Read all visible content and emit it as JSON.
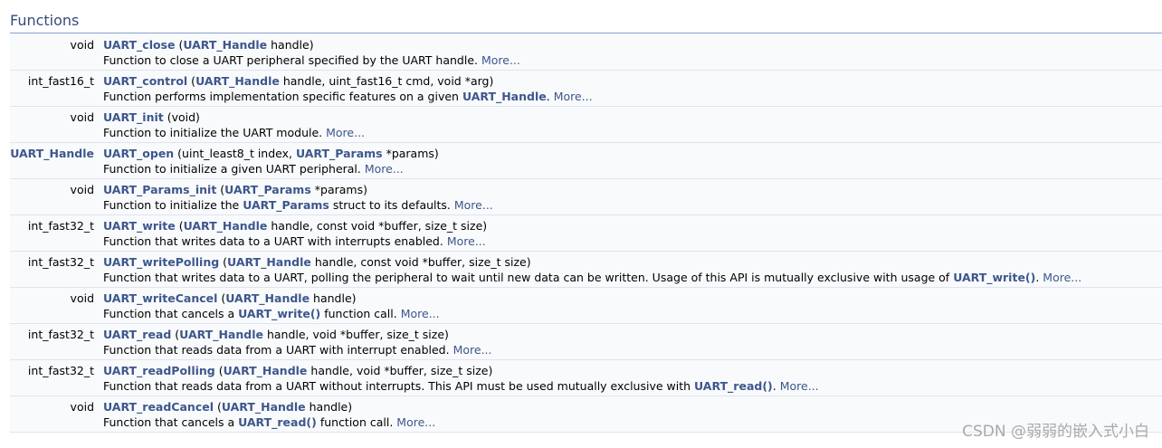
{
  "section": {
    "title": "Functions"
  },
  "functions": [
    {
      "ret": "void",
      "ret_link": false,
      "name": "UART_close",
      "sig": [
        {
          "t": " ("
        },
        {
          "l": "UART_Handle"
        },
        {
          "t": " handle)"
        }
      ],
      "brief": [
        {
          "t": "Function to close a UART peripheral specified by the UART handle. "
        },
        {
          "m": "More..."
        }
      ]
    },
    {
      "ret": "int_fast16_t",
      "ret_link": false,
      "name": "UART_control",
      "sig": [
        {
          "t": " ("
        },
        {
          "l": "UART_Handle"
        },
        {
          "t": " handle, uint_fast16_t cmd, void *arg)"
        }
      ],
      "brief": [
        {
          "t": "Function performs implementation specific features on a given "
        },
        {
          "l": "UART_Handle"
        },
        {
          "t": ". "
        },
        {
          "m": "More..."
        }
      ]
    },
    {
      "ret": "void",
      "ret_link": false,
      "name": "UART_init",
      "sig": [
        {
          "t": " (void)"
        }
      ],
      "brief": [
        {
          "t": "Function to initialize the UART module. "
        },
        {
          "m": "More..."
        }
      ]
    },
    {
      "ret": "UART_Handle",
      "ret_link": true,
      "name": "UART_open",
      "sig": [
        {
          "t": " (uint_least8_t index, "
        },
        {
          "l": "UART_Params"
        },
        {
          "t": " *params)"
        }
      ],
      "brief": [
        {
          "t": "Function to initialize a given UART peripheral. "
        },
        {
          "m": "More..."
        }
      ]
    },
    {
      "ret": "void",
      "ret_link": false,
      "name": "UART_Params_init",
      "sig": [
        {
          "t": " ("
        },
        {
          "l": "UART_Params"
        },
        {
          "t": " *params)"
        }
      ],
      "brief": [
        {
          "t": "Function to initialize the "
        },
        {
          "l": "UART_Params"
        },
        {
          "t": " struct to its defaults. "
        },
        {
          "m": "More..."
        }
      ]
    },
    {
      "ret": "int_fast32_t",
      "ret_link": false,
      "name": "UART_write",
      "sig": [
        {
          "t": " ("
        },
        {
          "l": "UART_Handle"
        },
        {
          "t": " handle, const void *buffer, size_t size)"
        }
      ],
      "brief": [
        {
          "t": "Function that writes data to a UART with interrupts enabled. "
        },
        {
          "m": "More..."
        }
      ]
    },
    {
      "ret": "int_fast32_t",
      "ret_link": false,
      "name": "UART_writePolling",
      "sig": [
        {
          "t": " ("
        },
        {
          "l": "UART_Handle"
        },
        {
          "t": " handle, const void *buffer, size_t size)"
        }
      ],
      "brief": [
        {
          "t": "Function that writes data to a UART, polling the peripheral to wait until new data can be written. Usage of this API is mutually exclusive with usage of "
        },
        {
          "l": "UART_write()"
        },
        {
          "t": ". "
        },
        {
          "m": "More..."
        }
      ]
    },
    {
      "ret": "void",
      "ret_link": false,
      "name": "UART_writeCancel",
      "sig": [
        {
          "t": " ("
        },
        {
          "l": "UART_Handle"
        },
        {
          "t": " handle)"
        }
      ],
      "brief": [
        {
          "t": "Function that cancels a "
        },
        {
          "l": "UART_write()"
        },
        {
          "t": " function call. "
        },
        {
          "m": "More..."
        }
      ]
    },
    {
      "ret": "int_fast32_t",
      "ret_link": false,
      "name": "UART_read",
      "sig": [
        {
          "t": " ("
        },
        {
          "l": "UART_Handle"
        },
        {
          "t": " handle, void *buffer, size_t size)"
        }
      ],
      "brief": [
        {
          "t": "Function that reads data from a UART with interrupt enabled. "
        },
        {
          "m": "More..."
        }
      ]
    },
    {
      "ret": "int_fast32_t",
      "ret_link": false,
      "name": "UART_readPolling",
      "sig": [
        {
          "t": " ("
        },
        {
          "l": "UART_Handle"
        },
        {
          "t": " handle, void *buffer, size_t size)"
        }
      ],
      "brief": [
        {
          "t": "Function that reads data from a UART without interrupts. This API must be used mutually exclusive with "
        },
        {
          "l": "UART_read()"
        },
        {
          "t": ". "
        },
        {
          "m": "More..."
        }
      ]
    },
    {
      "ret": "void",
      "ret_link": false,
      "name": "UART_readCancel",
      "sig": [
        {
          "t": " ("
        },
        {
          "l": "UART_Handle"
        },
        {
          "t": " handle)"
        }
      ],
      "brief": [
        {
          "t": "Function that cancels a "
        },
        {
          "l": "UART_read()"
        },
        {
          "t": " function call. "
        },
        {
          "m": "More..."
        }
      ]
    }
  ],
  "watermark": "CSDN @弱弱的嵌入式小白",
  "colors": {
    "link": "#3d578c",
    "title": "#354c7b",
    "row_bg": "#f9fafc",
    "row_border": "#dee4f0",
    "title_rule": "#879ecb"
  }
}
